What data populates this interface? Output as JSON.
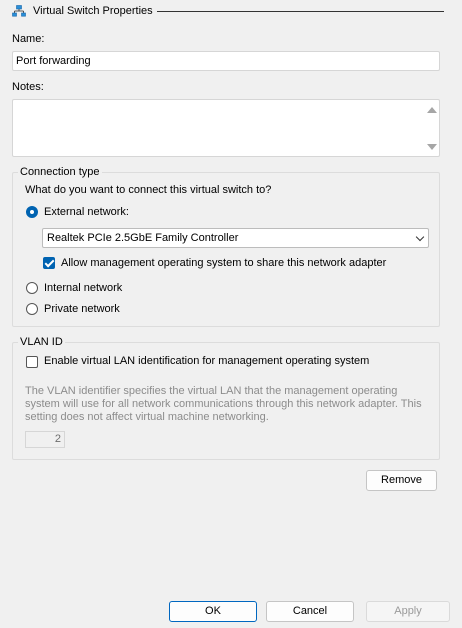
{
  "header": {
    "title": "Virtual Switch Properties",
    "icon": "network-switch-icon"
  },
  "name_field": {
    "label": "Name:",
    "value": "Port forwarding"
  },
  "notes_field": {
    "label": "Notes:",
    "value": ""
  },
  "connection": {
    "title": "Connection type",
    "question": "What do you want to connect this virtual switch to?",
    "external": {
      "label": "External network:",
      "checked": true
    },
    "adapter": {
      "selected": "Realtek PCIe 2.5GbE Family Controller"
    },
    "allow_mgmt": {
      "label": "Allow management operating system to share this network adapter",
      "checked": true
    },
    "internal": {
      "label": "Internal network",
      "checked": false
    },
    "private": {
      "label": "Private network",
      "checked": false
    }
  },
  "vlan": {
    "title": "VLAN ID",
    "enable_label": "Enable virtual LAN identification for management operating system",
    "enable_checked": false,
    "description_lines": [
      "The VLAN identifier specifies the virtual LAN that the management operating",
      "system will use for all network communications through this network adapter. This",
      "setting does not affect virtual machine networking."
    ],
    "vlan_value": "2"
  },
  "buttons": {
    "remove": "Remove",
    "ok": "OK",
    "cancel": "Cancel",
    "apply": "Apply"
  },
  "colors": {
    "accent": "#0063b1",
    "background": "#f0f0f0"
  }
}
